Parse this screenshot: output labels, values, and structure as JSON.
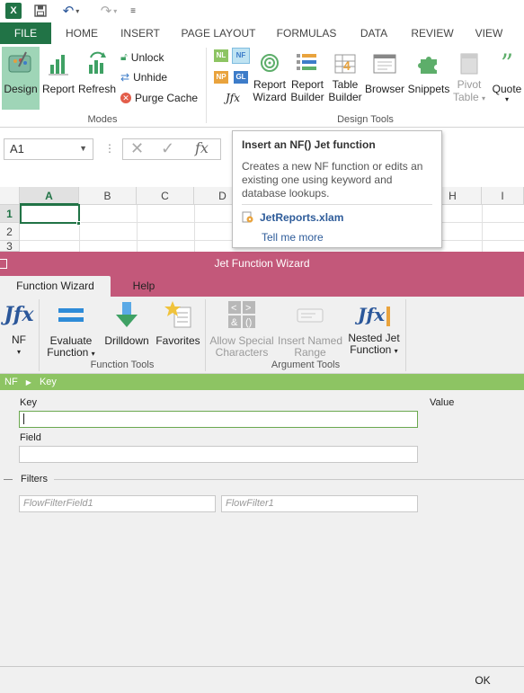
{
  "qat": {
    "excel_icon": "X",
    "save_icon": "save-icon",
    "undo_icon": "undo-icon",
    "redo_icon": "redo-icon"
  },
  "ribbon_tabs": [
    "FILE",
    "HOME",
    "INSERT",
    "PAGE LAYOUT",
    "FORMULAS",
    "DATA",
    "REVIEW",
    "VIEW"
  ],
  "ribbon": {
    "modes": {
      "design": "Design",
      "report": "Report",
      "refresh": "Refresh",
      "unlock": "Unlock",
      "unhide": "Unhide",
      "purge_cache": "Purge Cache",
      "group_label": "Modes"
    },
    "design_tools": {
      "nl": "NL",
      "nf": "NF",
      "np": "NP",
      "gl": "GL",
      "jfx": "Jfx",
      "report_wizard": [
        "Report",
        "Wizard"
      ],
      "report_builder": [
        "Report",
        "Builder"
      ],
      "table_builder": [
        "Table",
        "Builder"
      ],
      "browser": "Browser",
      "snippets": "Snippets",
      "pivot_table": [
        "Pivot",
        "Table"
      ],
      "quote": "Quote",
      "group_label": "Design Tools"
    }
  },
  "formula_bar": {
    "name_box": "A1"
  },
  "grid": {
    "columns": [
      "A",
      "B",
      "C",
      "D",
      "H",
      "I"
    ],
    "rows": [
      "1",
      "2",
      "3"
    ]
  },
  "tooltip": {
    "title": "Insert an NF() Jet function",
    "description": "Creates a new NF function or edits an existing one using keyword and database lookups.",
    "addin": "JetReports.xlam",
    "tell_me_more": "Tell me more"
  },
  "wizard": {
    "title": "Jet Function Wizard",
    "tabs": [
      "Function Wizard",
      "Help"
    ],
    "buttons": {
      "nf": "NF",
      "evaluate_function": [
        "Evaluate",
        "Function"
      ],
      "drilldown": "Drilldown",
      "favorites": "Favorites",
      "allow_special": [
        "Allow Special",
        "Characters"
      ],
      "insert_named": [
        "Insert Named",
        "Range"
      ],
      "nested_jet": [
        "Nested Jet",
        "Function"
      ]
    },
    "groups": {
      "function_tools": "Function Tools",
      "argument_tools": "Argument Tools"
    },
    "breadcrumb": [
      "NF",
      "Key"
    ],
    "fields": {
      "key_label": "Key",
      "value_label": "Value",
      "field_label": "Field",
      "filters_label": "Filters",
      "flow_filter_field_placeholder": "FlowFilterField1",
      "flow_filter_placeholder": "FlowFilter1"
    },
    "ok": "OK"
  },
  "colors": {
    "excel_green": "#217346",
    "wizard_titlebar": "#c3587a",
    "breadcrumb_green": "#8dc463"
  }
}
